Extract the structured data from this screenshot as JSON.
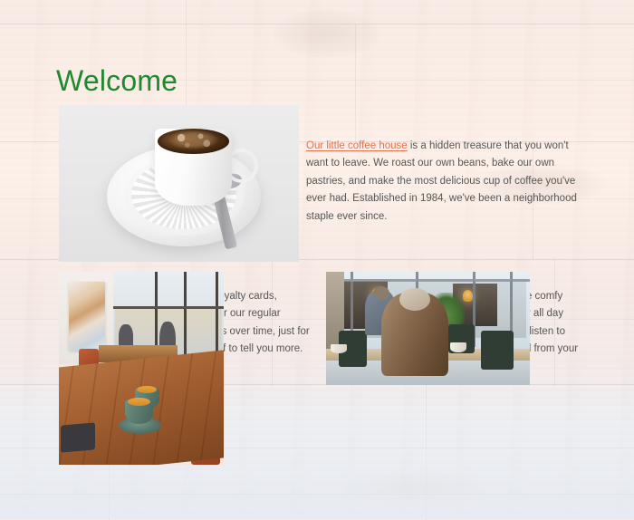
{
  "page": {
    "heading": "Welcome",
    "heading_color": "#1e8a2e",
    "link_color": "#e8704a",
    "body_text_color": "#565656",
    "background": "whitewashed wood planks"
  },
  "section_intro": {
    "image": {
      "name": "cappuccino-cup-photo",
      "alt": "White cappuccino cup and saucer with lace doily and spoon"
    },
    "link_text": "Our little coffee house",
    "paragraph_rest": " is a hidden treasure that you won't want to leave. We roast our own beans, bake our own pastries, and make the most delicious cup of coffee you've ever had. Established in 1984, we've been a neighborhood staple ever since."
  },
  "section_perks": {
    "image": {
      "name": "cafe-communal-table-photo",
      "alt": "Cafe interior with long wooden communal table and green espresso cups"
    },
    "paragraph": "As an added bonus, we also offer loyalty cards, discounts, and other coffee perks for our regular customers, so you can earn rewards over time, just for drinking coffee. Ask our friendly staff to tell you more."
  },
  "section_seating": {
    "image": {
      "name": "cafe-window-seating-photo",
      "alt": "Person seated from behind at a cafe window counter"
    },
    "paragraph": "Along with our amazing coffee, we also have comfy seating with free Wi-fi, so that you can linger all day long. Chat with friends, get your work done, listen to music, or just people-watch. You can do it all from your perch in our cafe."
  }
}
